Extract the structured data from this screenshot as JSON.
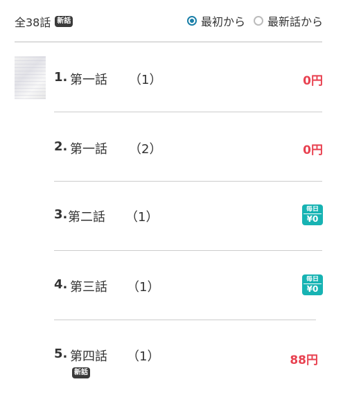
{
  "header": {
    "total_label": "全38話",
    "new_badge": "新話",
    "sort_options": [
      {
        "label": "最初から",
        "selected": true
      },
      {
        "label": "最新話から",
        "selected": false
      }
    ]
  },
  "episodes": [
    {
      "number": "1.",
      "title": "第一話",
      "sub": "（1）",
      "price": "0円"
    },
    {
      "number": "2.",
      "title": "第一話",
      "sub": "（2）",
      "price": "0円"
    },
    {
      "number": "3.",
      "title": "第二話",
      "sub": "（1）",
      "badge_top": "毎日",
      "badge_bottom": "¥0"
    },
    {
      "number": "4.",
      "title": "第三話",
      "sub": "（1）",
      "badge_top": "毎日",
      "badge_bottom": "¥0"
    },
    {
      "number": "5.",
      "title": "第四話",
      "sub": "（1）",
      "price": "88円",
      "new_badge": "新話"
    }
  ],
  "colors": {
    "accent": "#1a7fa8",
    "price": "#e84150",
    "free_badge": "#17b3b3"
  },
  "icons": {
    "thumbnail": "episode-thumbnail",
    "radio": "radio-icon"
  }
}
